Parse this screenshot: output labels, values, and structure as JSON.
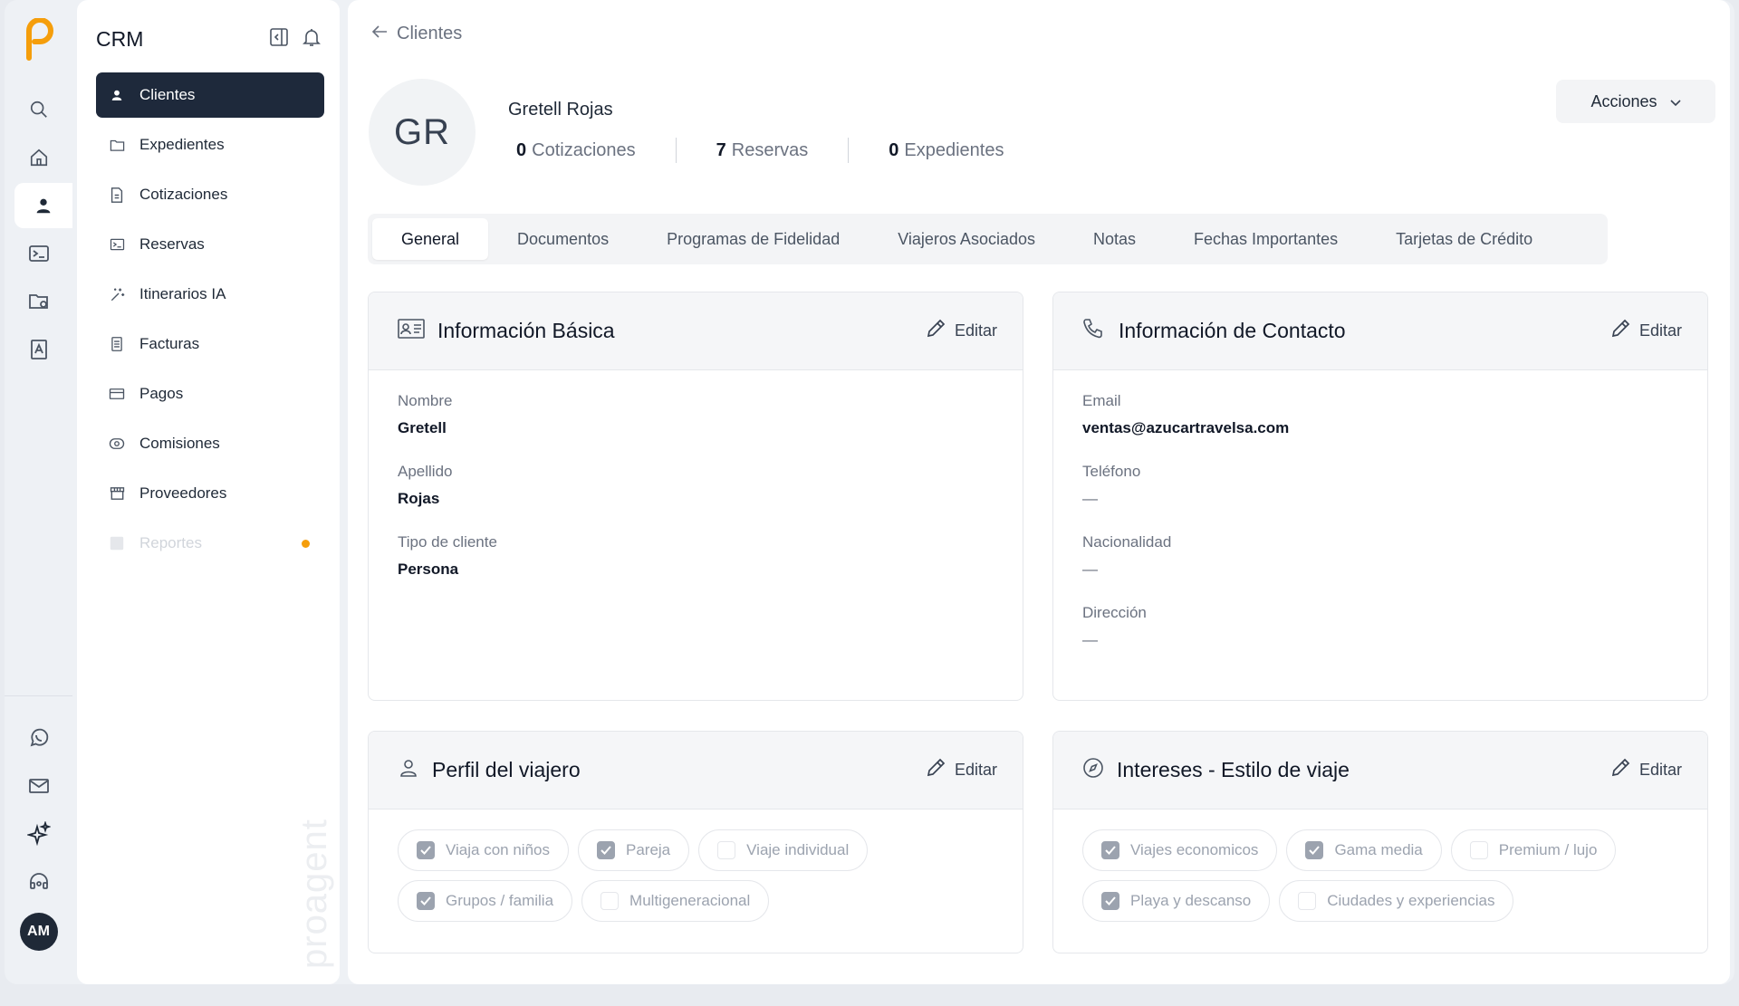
{
  "rail": {
    "icons": [
      "search-icon",
      "home-icon",
      "user-icon",
      "terminal-icon",
      "folder-settings-icon",
      "contacts-book-icon",
      "whatsapp-icon",
      "mail-icon",
      "sparkles-icon",
      "support-icon"
    ],
    "avatar_initials": "AM"
  },
  "nav": {
    "title": "CRM",
    "items": [
      {
        "label": "Clientes",
        "icon": "user-icon",
        "active": true
      },
      {
        "label": "Expedientes",
        "icon": "folder-icon"
      },
      {
        "label": "Cotizaciones",
        "icon": "document-icon"
      },
      {
        "label": "Reservas",
        "icon": "ticket-icon"
      },
      {
        "label": "Itinerarios IA",
        "icon": "magic-wand-icon"
      },
      {
        "label": "Facturas",
        "icon": "invoice-icon"
      },
      {
        "label": "Pagos",
        "icon": "credit-card-icon"
      },
      {
        "label": "Comisiones",
        "icon": "money-icon"
      },
      {
        "label": "Proveedores",
        "icon": "store-icon"
      },
      {
        "label": "Reportes",
        "icon": "report-icon",
        "disabled": true
      }
    ],
    "watermark": "proagent"
  },
  "header": {
    "back_label": "Clientes",
    "initials": "GR",
    "name": "Gretell Rojas",
    "stats": [
      {
        "value": "0",
        "label": "Cotizaciones"
      },
      {
        "value": "7",
        "label": "Reservas"
      },
      {
        "value": "0",
        "label": "Expedientes"
      }
    ],
    "actions_label": "Acciones"
  },
  "tabs": [
    "General",
    "Documentos",
    "Programas de Fidelidad",
    "Viajeros Asociados",
    "Notas",
    "Fechas Importantes",
    "Tarjetas de Crédito"
  ],
  "basic_info": {
    "title": "Información Básica",
    "edit_label": "Editar",
    "fields": [
      {
        "label": "Nombre",
        "value": "Gretell"
      },
      {
        "label": "Apellido",
        "value": "Rojas"
      },
      {
        "label": "Tipo de cliente",
        "value": "Persona"
      }
    ]
  },
  "contact_info": {
    "title": "Información de Contacto",
    "edit_label": "Editar",
    "fields": [
      {
        "label": "Email",
        "value": "ventas@azucartravelsa.com"
      },
      {
        "label": "Teléfono",
        "value": "—"
      },
      {
        "label": "Nacionalidad",
        "value": "—"
      },
      {
        "label": "Dirección",
        "value": "—"
      }
    ]
  },
  "traveler_profile": {
    "title": "Perfil del viajero",
    "edit_label": "Editar",
    "options": [
      {
        "label": "Viaja con niños",
        "checked": true
      },
      {
        "label": "Pareja",
        "checked": true
      },
      {
        "label": "Viaje individual",
        "checked": false
      },
      {
        "label": "Grupos / familia",
        "checked": true
      },
      {
        "label": "Multigeneracional",
        "checked": false
      }
    ]
  },
  "interests": {
    "title": "Intereses - Estilo de viaje",
    "edit_label": "Editar",
    "options": [
      {
        "label": "Viajes economicos",
        "checked": true
      },
      {
        "label": "Gama media",
        "checked": true
      },
      {
        "label": "Premium / lujo",
        "checked": false
      },
      {
        "label": "Playa y descanso",
        "checked": true
      },
      {
        "label": "Ciudades y experiencias",
        "checked": false
      }
    ]
  },
  "colors": {
    "accent": "#f59e0b",
    "active_nav": "#1e293b"
  }
}
